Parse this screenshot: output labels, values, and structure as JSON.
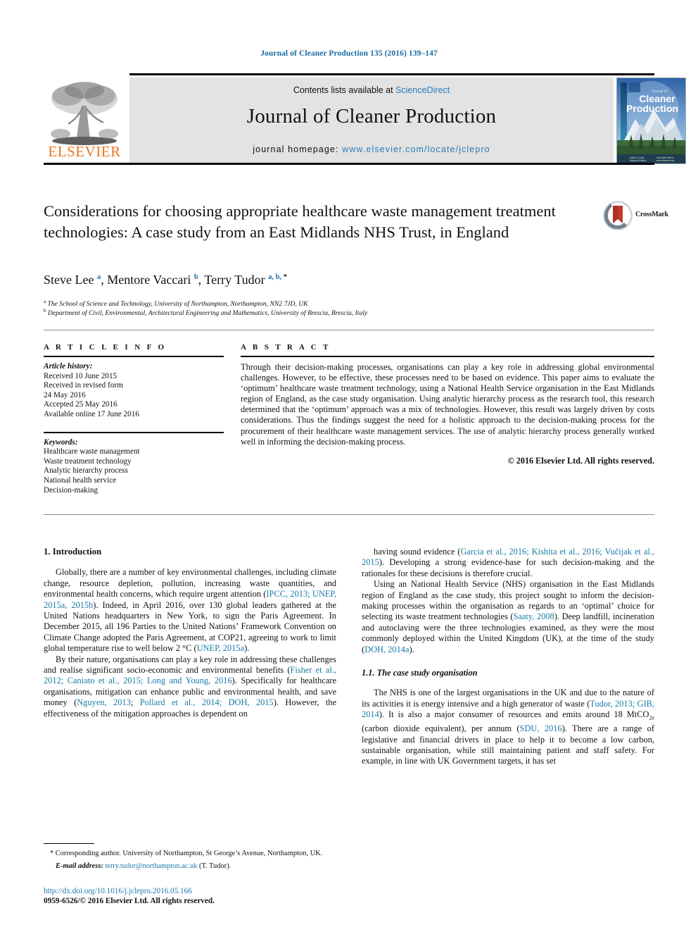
{
  "running_head": "Journal of Cleaner Production 135 (2016) 139–147",
  "masthead": {
    "contents_prefix": "Contents lists available at ",
    "sciencedirect": "ScienceDirect",
    "journal_title": "Journal of Cleaner Production",
    "homepage_prefix": "journal homepage: ",
    "homepage_url": "www.elsevier.com/locate/jclepro",
    "publisher": "ELSEVIER",
    "cover_title_line1": "Journal of",
    "cover_title_line2": "Cleaner",
    "cover_title_line3": "Production",
    "accent_blue": "#2b7bb9",
    "publisher_orange": "#e87722",
    "band_gray": "#e3e3e3"
  },
  "crossmark": {
    "label": "CrossMark"
  },
  "article": {
    "title": "Considerations for choosing appropriate healthcare waste management treatment technologies: A case study from an East Midlands NHS Trust, in England",
    "authors_html": "Steve Lee <sup>a</sup>, Mentore Vaccari <sup>b</sup>, Terry Tudor <sup>a, b, </sup><sup class=\"ast\">*</sup>",
    "affiliation_a": "The School of Science and Technology, University of Northampton, Northampton, NN2 7JD, UK",
    "affiliation_b": "Department of Civil, Environmental, Architectural Engineering and Mathematics, University of Brescia, Brescia, Italy"
  },
  "article_info": {
    "heading": "A R T I C L E   I N F O",
    "history_label": "Article history:",
    "history": [
      "Received 10 June 2015",
      "Received in revised form",
      "24 May 2016",
      "Accepted 25 May 2016",
      "Available online 17 June 2016"
    ],
    "keywords_label": "Keywords:",
    "keywords": [
      "Healthcare waste management",
      "Waste treatment technology",
      "Analytic hierarchy process",
      "National health service",
      "Decision-making"
    ]
  },
  "abstract": {
    "heading": "A B S T R A C T",
    "text": "Through their decision-making processes, organisations can play a key role in addressing global environmental challenges. However, to be effective, these processes need to be based on evidence. This paper aims to evaluate the ‘optimum’ healthcare waste treatment technology, using a National Health Service organisation in the East Midlands region of England, as the case study organisation. Using analytic hierarchy process as the research tool, this research determined that the ‘optimum’ approach was a mix of technologies. However, this result was largely driven by costs considerations. Thus the findings suggest the need for a holistic approach to the decision-making process for the procurement of their healthcare waste management services. The use of analytic hierarchy process generally worked well in informing the decision-making process.",
    "copyright": "© 2016 Elsevier Ltd. All rights reserved."
  },
  "body": {
    "section1_heading": "1. Introduction",
    "subsection_1_1_heading": "1.1. The case study organisation",
    "para1_html": "Globally, there are a number of key environmental challenges, including climate change, resource depletion, pollution, increasing waste quantities, and environmental health concerns, which require urgent attention (<span class=\"cit\" data-name=\"citation-link\" data-interactable=\"true\">IPCC, 2013; UNEP, 2015a, 2015b</span>). Indeed, in April 2016, over 130 global leaders gathered at the United Nations headquarters in New York, to sign the Paris Agreement. In December 2015, all 196 Parties to the United Nations’ Framework Convention on Climate Change adopted the Paris Agreement, at COP21, agreeing to work to limit global temperature rise to well below 2 °C (<span class=\"cit\" data-name=\"citation-link\" data-interactable=\"true\">UNEP, 2015a</span>).",
    "para2_html": "By their nature, organisations can play a key role in addressing these challenges and realise significant socio-economic and environmental benefits (<span class=\"cit\" data-name=\"citation-link\" data-interactable=\"true\">Fisher et al., 2012; Caniato et al., 2015; Long and Young, 2016</span>). Specifically for healthcare organisations, mitigation can enhance public and environmental health, and save money (<span class=\"cit\" data-name=\"citation-link\" data-interactable=\"true\">Nguyen, 2013</span>; <span class=\"cit\" data-name=\"citation-link\" data-interactable=\"true\">Pollard et al., 2014; DOH, 2015</span>). However, the effectiveness of the mitigation approaches is dependent on",
    "para3_html": "having sound evidence (<span class=\"cit\" data-name=\"citation-link\" data-interactable=\"true\">Garcia et al., 2016; Kishita et al., 2016; Vučijak et al., 2015</span>). Developing a strong evidence-base for such decision-making and the rationales for these decisions is therefore crucial.",
    "para4_html": "Using an National Health Service (NHS) organisation in the East Midlands region of England as the case study, this project sought to inform the decision-making processes within the organisation as regards to an ‘optimal’ choice for selecting its waste treatment technologies (<span class=\"cit\" data-name=\"citation-link\" data-interactable=\"true\">Saaty, 2008</span>). Deep landfill, incineration and autoclaving were the three technologies examined, as they were the most commonly deployed within the United Kingdom (UK), at the time of the study (<span class=\"cit\" data-name=\"citation-link\" data-interactable=\"true\">DOH, 2014a</span>).",
    "para5_html": "The NHS is one of the largest organisations in the UK and due to the nature of its activities it is energy intensive and a high generator of waste (<span class=\"cit\" data-name=\"citation-link\" data-interactable=\"true\">Tudor, 2013; GIB, 2014</span>). It is also a major consumer of resources and emits around 18 MtCO<sub class=\"small\">2e</sub> (carbon dioxide equivalent), per annum (<span class=\"cit\" data-name=\"citation-link\" data-interactable=\"true\">SDU, 2016</span>). There are a range of legislative and financial drivers in place to help it to become a low carbon, sustainable organisation, while still maintaining patient and staff safety. For example, in line with UK Government targets, it has set"
  },
  "footnotes": {
    "corresponding_html": "* Corresponding author. University of Northampton, St George’s Avenue, Northampton, UK.",
    "email_html": "<i>E-mail address:</i> <span class=\"link\" data-name=\"email-link\" data-interactable=\"true\">terry.tudor@northampton.ac.uk</span> (T. Tudor).",
    "doi_url": "http://dx.doi.org/10.1016/j.jclepro.2016.05.166",
    "issn_line": "0959-6526/© 2016 Elsevier Ltd. All rights reserved."
  }
}
